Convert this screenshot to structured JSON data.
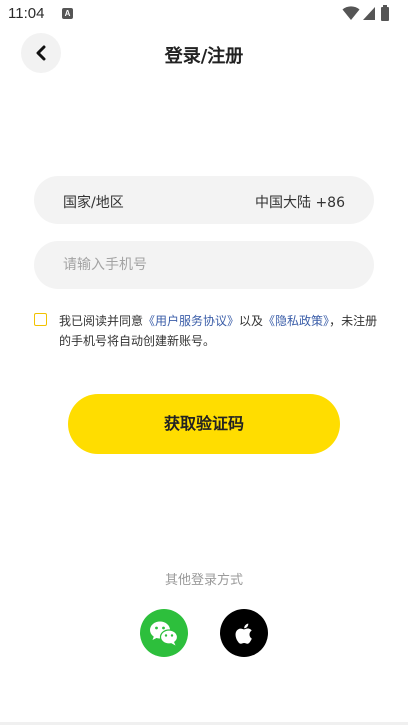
{
  "status_bar": {
    "time": "11:04",
    "notification_badge": "A"
  },
  "header": {
    "title": "登录/注册"
  },
  "region": {
    "label": "国家/地区",
    "value": "中国大陆 +86"
  },
  "phone": {
    "placeholder": "请输入手机号",
    "value": ""
  },
  "agreement": {
    "prefix": "我已阅读并同意",
    "user_agreement_link": "《用户服务协议》",
    "conjunction": "以及",
    "privacy_link": "《隐私政策》",
    "suffix": "，未注册的手机号将自动创建新账号。",
    "checked": false
  },
  "primary_button": {
    "label": "获取验证码",
    "color": "#ffdd00"
  },
  "other_login": {
    "label": "其他登录方式",
    "methods": [
      {
        "icon": "wechat-icon",
        "color": "#2dbf3c"
      },
      {
        "icon": "apple-icon",
        "color": "#000000"
      }
    ]
  }
}
